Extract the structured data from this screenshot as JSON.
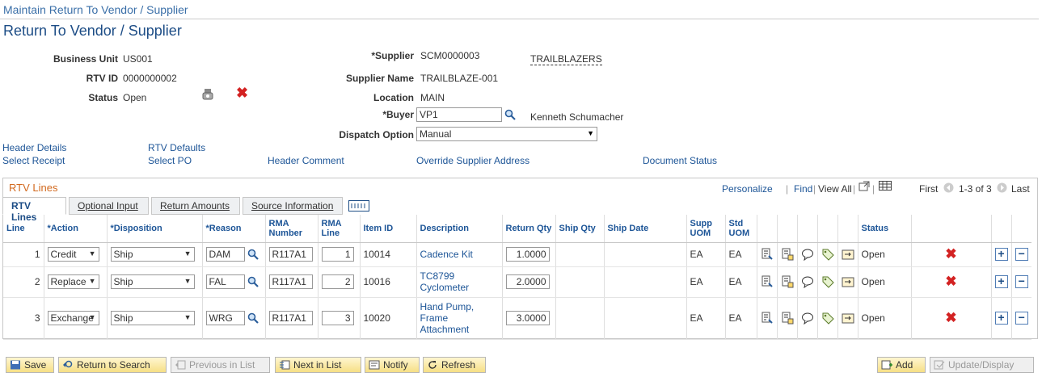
{
  "breadcrumb": "Maintain Return To Vendor / Supplier",
  "page_title": "Return To Vendor / Supplier",
  "header": {
    "business_unit_label": "Business Unit",
    "business_unit": "US001",
    "rtv_id_label": "RTV ID",
    "rtv_id": "0000000002",
    "status_label": "Status",
    "status": "Open",
    "supplier_label": "*Supplier",
    "supplier": "SCM0000003",
    "supplier_short": "TRAILBLAZERS",
    "supplier_name_label": "Supplier Name",
    "supplier_name": "TRAILBLAZE-001",
    "location_label": "Location",
    "location": "MAIN",
    "buyer_label": "*Buyer",
    "buyer": "VP1",
    "buyer_name": "Kenneth Schumacher",
    "dispatch_label": "Dispatch Option",
    "dispatch": "Manual"
  },
  "links": {
    "header_details": "Header Details",
    "rtv_defaults": "RTV Defaults",
    "select_receipt": "Select Receipt",
    "select_po": "Select PO",
    "header_comment": "Header Comment",
    "override_address": "Override Supplier Address",
    "document_status": "Document Status"
  },
  "grid": {
    "title": "RTV Lines",
    "personalize": "Personalize",
    "find": "Find",
    "view_all": "View All",
    "first": "First",
    "range": "1-3 of 3",
    "last": "Last",
    "tabs": [
      "RTV Lines",
      "Optional Input",
      "Return Amounts",
      "Source Information"
    ],
    "columns": {
      "line": "Line",
      "action": "*Action",
      "disposition": "*Disposition",
      "reason": "*Reason",
      "rma_number": "RMA Number",
      "rma_line": "RMA Line",
      "item_id": "Item ID",
      "description": "Description",
      "return_qty": "Return Qty",
      "ship_qty": "Ship Qty",
      "ship_date": "Ship Date",
      "supp_uom": "Supp UOM",
      "std_uom": "Std UOM",
      "status": "Status"
    },
    "rows": [
      {
        "line": "1",
        "action": "Credit",
        "disposition": "Ship",
        "reason": "DAM",
        "rma": "R117A1",
        "rma_line": "1",
        "item": "10014",
        "desc": "Cadence Kit",
        "qty": "1.0000",
        "supp_uom": "EA",
        "std_uom": "EA",
        "status": "Open"
      },
      {
        "line": "2",
        "action": "Replace",
        "disposition": "Ship",
        "reason": "FAL",
        "rma": "R117A1",
        "rma_line": "2",
        "item": "10016",
        "desc": "TC8799 Cyclometer",
        "qty": "2.0000",
        "supp_uom": "EA",
        "std_uom": "EA",
        "status": "Open"
      },
      {
        "line": "3",
        "action": "Exchange",
        "disposition": "Ship",
        "reason": "WRG",
        "rma": "R117A1",
        "rma_line": "3",
        "item": "10020",
        "desc": "Hand Pump, Frame Attachment",
        "qty": "3.0000",
        "supp_uom": "EA",
        "std_uom": "EA",
        "status": "Open"
      }
    ]
  },
  "toolbar": {
    "save": "Save",
    "return_search": "Return to Search",
    "prev": "Previous in List",
    "next": "Next in List",
    "notify": "Notify",
    "refresh": "Refresh",
    "add": "Add",
    "update": "Update/Display"
  }
}
